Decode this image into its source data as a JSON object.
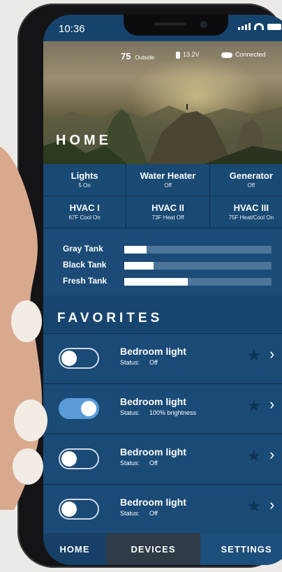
{
  "status_bar": {
    "time": "10:36"
  },
  "hero": {
    "temp_value": "75",
    "temp_label": "Outside",
    "voltage": "13.2V",
    "connection": "Connected",
    "title": "HOME"
  },
  "quick_status": [
    {
      "title": "Lights",
      "sub": "5 On"
    },
    {
      "title": "Water Heater",
      "sub": "Off"
    },
    {
      "title": "Generator",
      "sub": "Off"
    },
    {
      "title": "HVAC I",
      "sub": "67F Cool On"
    },
    {
      "title": "HVAC II",
      "sub": "73F Heat Off"
    },
    {
      "title": "HVAC III",
      "sub": "75F Heat/Cool On"
    }
  ],
  "tanks": [
    {
      "label": "Gray Tank",
      "level": 0.15
    },
    {
      "label": "Black Tank",
      "level": 0.2
    },
    {
      "label": "Fresh Tank",
      "level": 0.43
    }
  ],
  "favorites": {
    "title": "FAVORITES",
    "items": [
      {
        "name": "Bedroom light",
        "status_label": "Status:",
        "status_value": "Off",
        "on": false
      },
      {
        "name": "Bedroom light",
        "status_label": "Status:",
        "status_value": "100% brightness",
        "on": true
      },
      {
        "name": "Bedroom light",
        "status_label": "Status:",
        "status_value": "Off",
        "on": false
      },
      {
        "name": "Bedroom light",
        "status_label": "Status:",
        "status_value": "Off",
        "on": false
      }
    ]
  },
  "tabs": [
    {
      "label": "HOME",
      "active": true
    },
    {
      "label": "DEVICES",
      "active": false
    },
    {
      "label": "SETTINGS",
      "active": false
    }
  ],
  "colors": {
    "primary": "#16436b",
    "panel": "#1a4a76",
    "toggle_on": "#5a9bd8",
    "tank_track": "#4d7499"
  }
}
